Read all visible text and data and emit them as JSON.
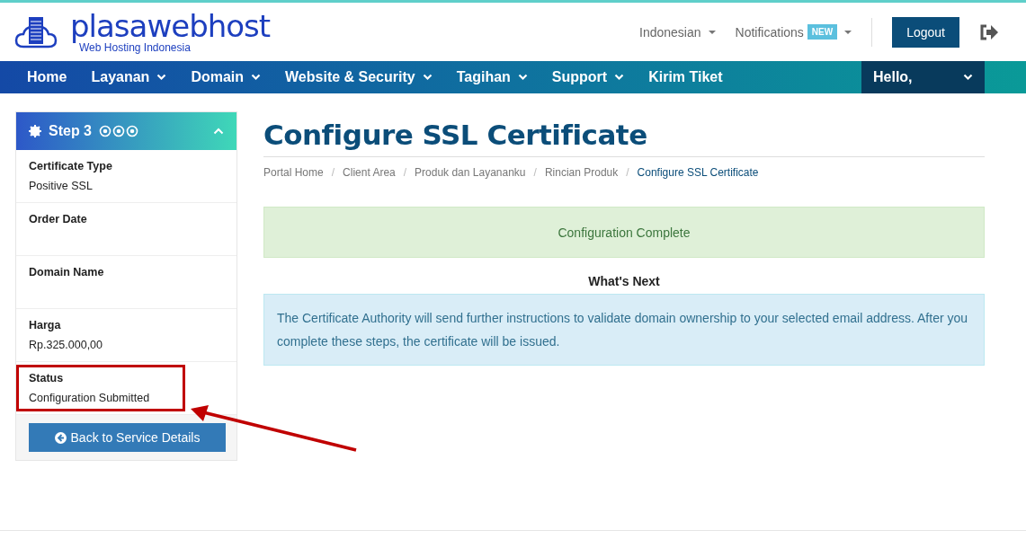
{
  "header": {
    "logo": {
      "name": "plasawebhost",
      "tagline": "Web Hosting Indonesia"
    },
    "language": "Indonesian",
    "notifications": {
      "label": "Notifications",
      "badge": "NEW"
    },
    "logout": "Logout"
  },
  "nav": {
    "items": [
      {
        "label": "Home",
        "has_caret": false
      },
      {
        "label": "Layanan",
        "has_caret": true
      },
      {
        "label": "Domain",
        "has_caret": true
      },
      {
        "label": "Website & Security",
        "has_caret": true
      },
      {
        "label": "Tagihan",
        "has_caret": true
      },
      {
        "label": "Support",
        "has_caret": true
      },
      {
        "label": "Kirim Tiket",
        "has_caret": false
      }
    ],
    "user": "Hello,"
  },
  "sidebar": {
    "title": "Step 3",
    "expanded": true,
    "fields": [
      {
        "label": "Certificate Type",
        "value": "Positive SSL"
      },
      {
        "label": "Order Date"
      },
      {
        "label": "Domain Name"
      },
      {
        "label": "Harga",
        "value": "Rp.325.000,00"
      },
      {
        "label": "Status",
        "value": "Configuration Submitted",
        "highlighted": true
      }
    ],
    "button": "Back to Service Details"
  },
  "main": {
    "title": "Configure SSL Certificate",
    "breadcrumb": [
      {
        "label": "Portal Home",
        "selected": false
      },
      {
        "separator": "/",
        "label": "Client Area",
        "selected": false
      },
      {
        "separator": "/",
        "label": "Produk dan Layananku",
        "selected": false
      },
      {
        "separator": "/",
        "label": "Rincian Produk",
        "selected": false
      },
      {
        "separator": "/",
        "label": "Configure SSL Certificate",
        "selected": true
      }
    ],
    "success": "Configuration Complete",
    "next_heading": "What's Next",
    "info": "The Certificate Authority will send further instructions to validate domain ownership to your selected email address. After you complete these steps, the certificate will be issued."
  }
}
